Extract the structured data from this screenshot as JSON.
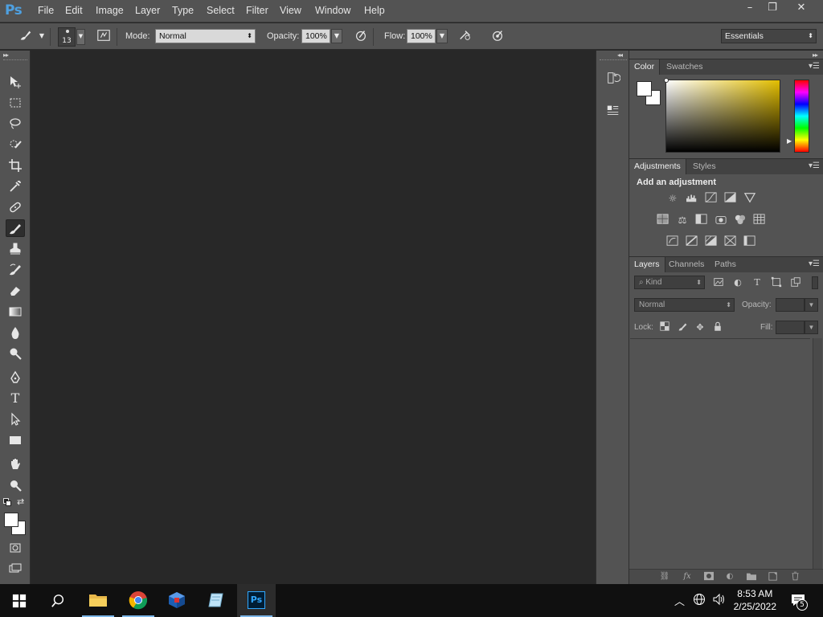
{
  "app": {
    "logo": "Ps"
  },
  "menu": [
    "File",
    "Edit",
    "Image",
    "Layer",
    "Type",
    "Select",
    "Filter",
    "View",
    "Window",
    "Help"
  ],
  "window_controls": {
    "minimize": "–",
    "restore": "❐",
    "close": "✕"
  },
  "options_bar": {
    "brush_size": "13",
    "mode_label": "Mode:",
    "mode_value": "Normal",
    "opacity_label": "Opacity:",
    "opacity_value": "100%",
    "flow_label": "Flow:",
    "flow_value": "100%",
    "workspace": "Essentials"
  },
  "tools": [
    {
      "name": "move-tool",
      "icon": "move-icon"
    },
    {
      "name": "marquee-tool",
      "icon": "marquee-icon"
    },
    {
      "name": "lasso-tool",
      "icon": "lasso-icon"
    },
    {
      "name": "quick-selection-tool",
      "icon": "quick-selection-icon"
    },
    {
      "name": "crop-tool",
      "icon": "crop-icon"
    },
    {
      "name": "eyedropper-tool",
      "icon": "eyedropper-icon"
    },
    {
      "name": "healing-brush-tool",
      "icon": "bandage-icon"
    },
    {
      "name": "brush-tool",
      "icon": "brush-icon",
      "active": true
    },
    {
      "name": "clone-stamp-tool",
      "icon": "stamp-icon"
    },
    {
      "name": "history-brush-tool",
      "icon": "history-brush-icon"
    },
    {
      "name": "eraser-tool",
      "icon": "eraser-icon"
    },
    {
      "name": "gradient-tool",
      "icon": "gradient-icon"
    },
    {
      "name": "blur-tool",
      "icon": "drop-icon"
    },
    {
      "name": "dodge-tool",
      "icon": "dodge-icon"
    },
    {
      "name": "pen-tool",
      "icon": "pen-icon"
    },
    {
      "name": "type-tool",
      "icon": "type-icon"
    },
    {
      "name": "path-selection-tool",
      "icon": "arrow-icon"
    },
    {
      "name": "rectangle-tool",
      "icon": "rectangle-icon"
    },
    {
      "name": "hand-tool",
      "icon": "hand-icon"
    },
    {
      "name": "zoom-tool",
      "icon": "zoom-icon"
    }
  ],
  "swatches": {
    "foreground": "#ffffff",
    "background": "#ffffff"
  },
  "panels": {
    "color_tabs": [
      "Color",
      "Swatches"
    ],
    "adjustments_tabs": [
      "Adjustments",
      "Styles"
    ],
    "adjustments_title": "Add an adjustment",
    "layers_tabs": [
      "Layers",
      "Channels",
      "Paths"
    ],
    "layers_kind": "Kind",
    "layers_blend": "Normal",
    "layers_opacity_label": "Opacity:",
    "layers_lock_label": "Lock:",
    "layers_fill_label": "Fill:"
  },
  "taskbar": {
    "time": "8:53 AM",
    "date": "2/25/2022",
    "notification_count": "5"
  }
}
